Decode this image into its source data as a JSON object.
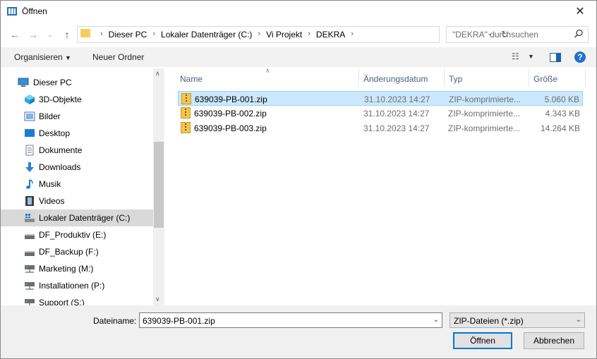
{
  "window": {
    "title": "Öffnen"
  },
  "navigation": {
    "breadcrumb": [
      "Dieser PC",
      "Lokaler Datenträger (C:)",
      "Vi Projekt",
      "DEKRA"
    ],
    "search_placeholder": "\"DEKRA\" durchsuchen"
  },
  "toolbar": {
    "organize_label": "Organisieren",
    "new_folder_label": "Neuer Ordner"
  },
  "sidebar": {
    "items": [
      {
        "label": "Dieser PC",
        "icon": "computer-icon"
      },
      {
        "label": "3D-Objekte",
        "icon": "cube-icon"
      },
      {
        "label": "Bilder",
        "icon": "pictures-icon"
      },
      {
        "label": "Desktop",
        "icon": "desktop-icon"
      },
      {
        "label": "Dokumente",
        "icon": "documents-icon"
      },
      {
        "label": "Downloads",
        "icon": "download-icon"
      },
      {
        "label": "Musik",
        "icon": "music-icon"
      },
      {
        "label": "Videos",
        "icon": "video-icon"
      },
      {
        "label": "Lokaler Datenträger (C:)",
        "icon": "drive-icon"
      },
      {
        "label": "DF_Produktiv (E:)",
        "icon": "drive-icon"
      },
      {
        "label": "DF_Backup (F:)",
        "icon": "drive-icon"
      },
      {
        "label": "Marketing (M:)",
        "icon": "network-drive-icon"
      },
      {
        "label": "Installationen (P:)",
        "icon": "network-drive-icon"
      },
      {
        "label": "Support (S:)",
        "icon": "network-drive-icon"
      }
    ],
    "selected_index": 8
  },
  "filelist": {
    "columns": [
      "Name",
      "Änderungsdatum",
      "Typ",
      "Größe"
    ],
    "rows": [
      {
        "name": "639039-PB-001.zip",
        "date": "31.10.2023 14:27",
        "type": "ZIP-komprimierte...",
        "size": "5.060 KB"
      },
      {
        "name": "639039-PB-002.zip",
        "date": "31.10.2023 14:27",
        "type": "ZIP-komprimierte...",
        "size": "4.343 KB"
      },
      {
        "name": "639039-PB-003.zip",
        "date": "31.10.2023 14:27",
        "type": "ZIP-komprimierte...",
        "size": "14.264 KB"
      }
    ],
    "selected_index": 0
  },
  "footer": {
    "filename_label": "Dateiname:",
    "filename_value": "639039-PB-001.zip",
    "filetype_value": "ZIP-Dateien (*.zip)",
    "open_label": "Öffnen",
    "cancel_label": "Abbrechen"
  },
  "colors": {
    "accent": "#0078d7",
    "selection": "#cce8ff",
    "sidebar_selection": "#d9d9d9"
  }
}
